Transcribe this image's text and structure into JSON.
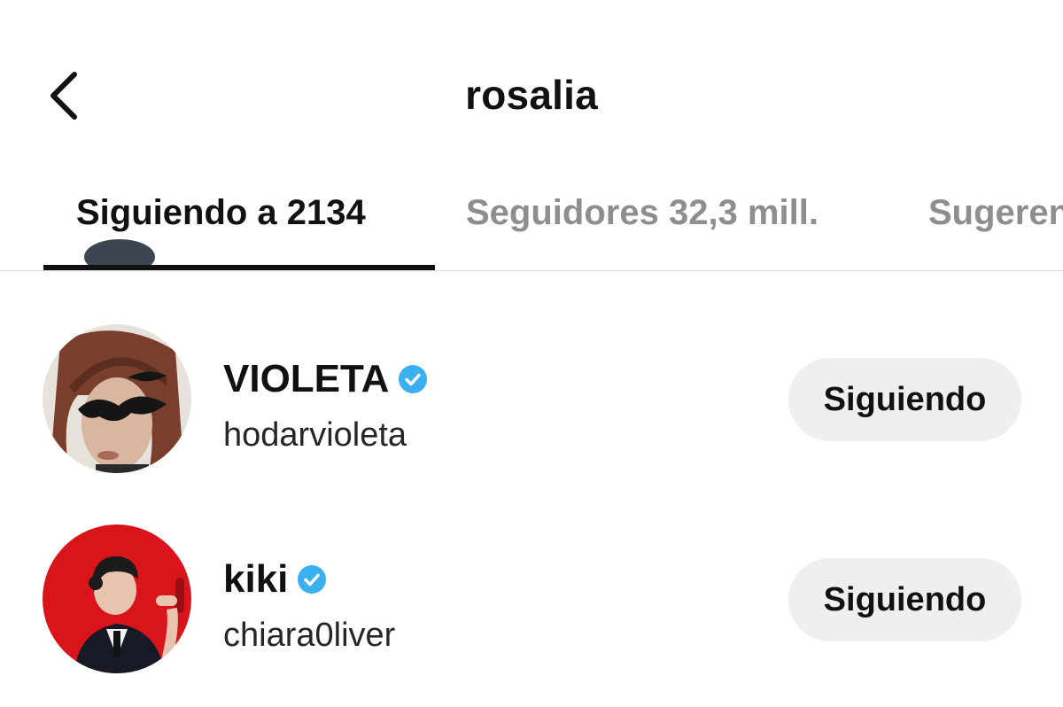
{
  "header": {
    "title": "rosalia",
    "back_icon": "chevron-left-icon"
  },
  "tabs": [
    {
      "label": "Siguiendo a 2134",
      "active": true
    },
    {
      "label": "Seguidores 32,3 mill.",
      "active": false
    },
    {
      "label": "Sugerencias",
      "active": false
    }
  ],
  "accounts": [
    {
      "display_name": "VIOLETA",
      "username": "hodarvioleta",
      "verified": true,
      "button_label": "Siguiendo"
    },
    {
      "display_name": "kiki",
      "username": "chiara0liver",
      "verified": true,
      "button_label": "Siguiendo"
    }
  ],
  "colors": {
    "verified_badge": "#3bb0f0",
    "button_bg": "#efefef",
    "inactive_tab": "#8e8e8e",
    "divider": "#dbdbdb"
  }
}
